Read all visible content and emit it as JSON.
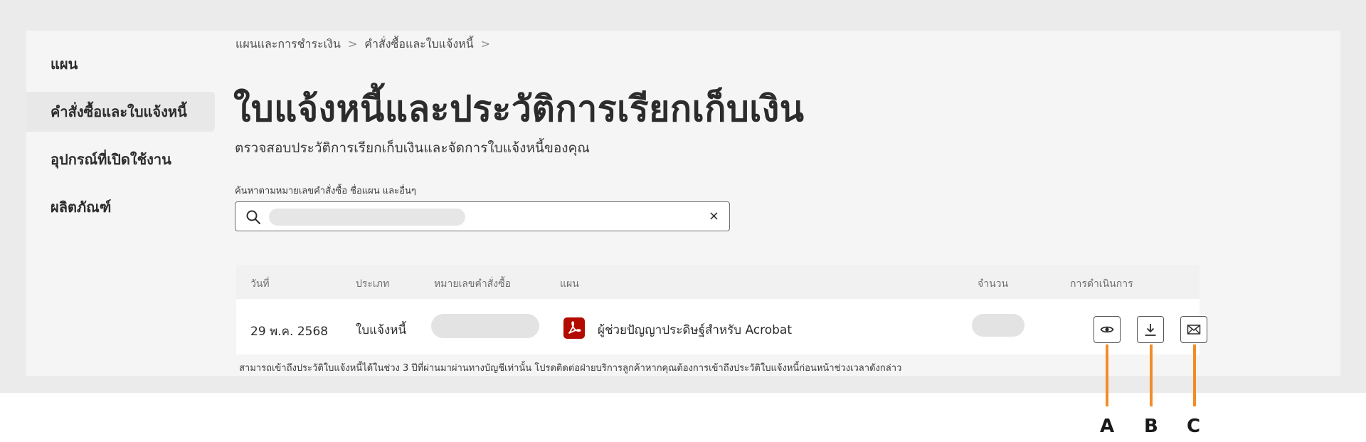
{
  "sidebar": {
    "items": [
      {
        "label": "แผน"
      },
      {
        "label": "คำสั่งซื้อและใบแจ้งหนี้"
      },
      {
        "label": "อุปกรณ์ที่เปิดใช้งาน"
      },
      {
        "label": "ผลิตภัณฑ์"
      }
    ]
  },
  "breadcrumb": {
    "items": [
      "แผนและการชำระเงิน",
      "คำสั่งซื้อและใบแจ้งหนี้"
    ],
    "separator": ">"
  },
  "page": {
    "title": "ใบแจ้งหนี้และประวัติการเรียกเก็บเงิน",
    "subtitle": "ตรวจสอบประวัติการเรียกเก็บเงินและจัดการใบแจ้งหนี้ของคุณ"
  },
  "search": {
    "label": "ค้นหาตามหมายเลขคำสั่งซื้อ ชื่อแผน และอื่นๆ",
    "clear_symbol": "×"
  },
  "table": {
    "headers": [
      "วันที่",
      "ประเภท",
      "หมายเลขคำสั่งซื้อ",
      "แผน",
      "จำนวน",
      "การดำเนินการ"
    ],
    "rows": [
      {
        "date": "29 พ.ค. 2568",
        "type": "ใบแจ้งหนี้",
        "plan": "ผู้ช่วยปัญญาประดิษฐ์สำหรับ Acrobat"
      }
    ],
    "note": "สามารถเข้าถึงประวัติใบแจ้งหนี้ได้ในช่วง 3 ปีที่ผ่านมาผ่านทางบัญชีเท่านั้น โปรดติดต่อฝ่ายบริการลูกค้าหากคุณต้องการเข้าถึงประวัติใบแจ้งหนี้ก่อนหน้าช่วงเวลาดังกล่าว"
  },
  "actions": {
    "icons": [
      "eye-icon",
      "download-icon",
      "mail-icon"
    ]
  },
  "callouts": [
    "A",
    "B",
    "C"
  ],
  "colors": {
    "accent_orange": "#f28c28",
    "acrobat_red": "#b30b00",
    "panel_bg": "#f5f5f5"
  }
}
